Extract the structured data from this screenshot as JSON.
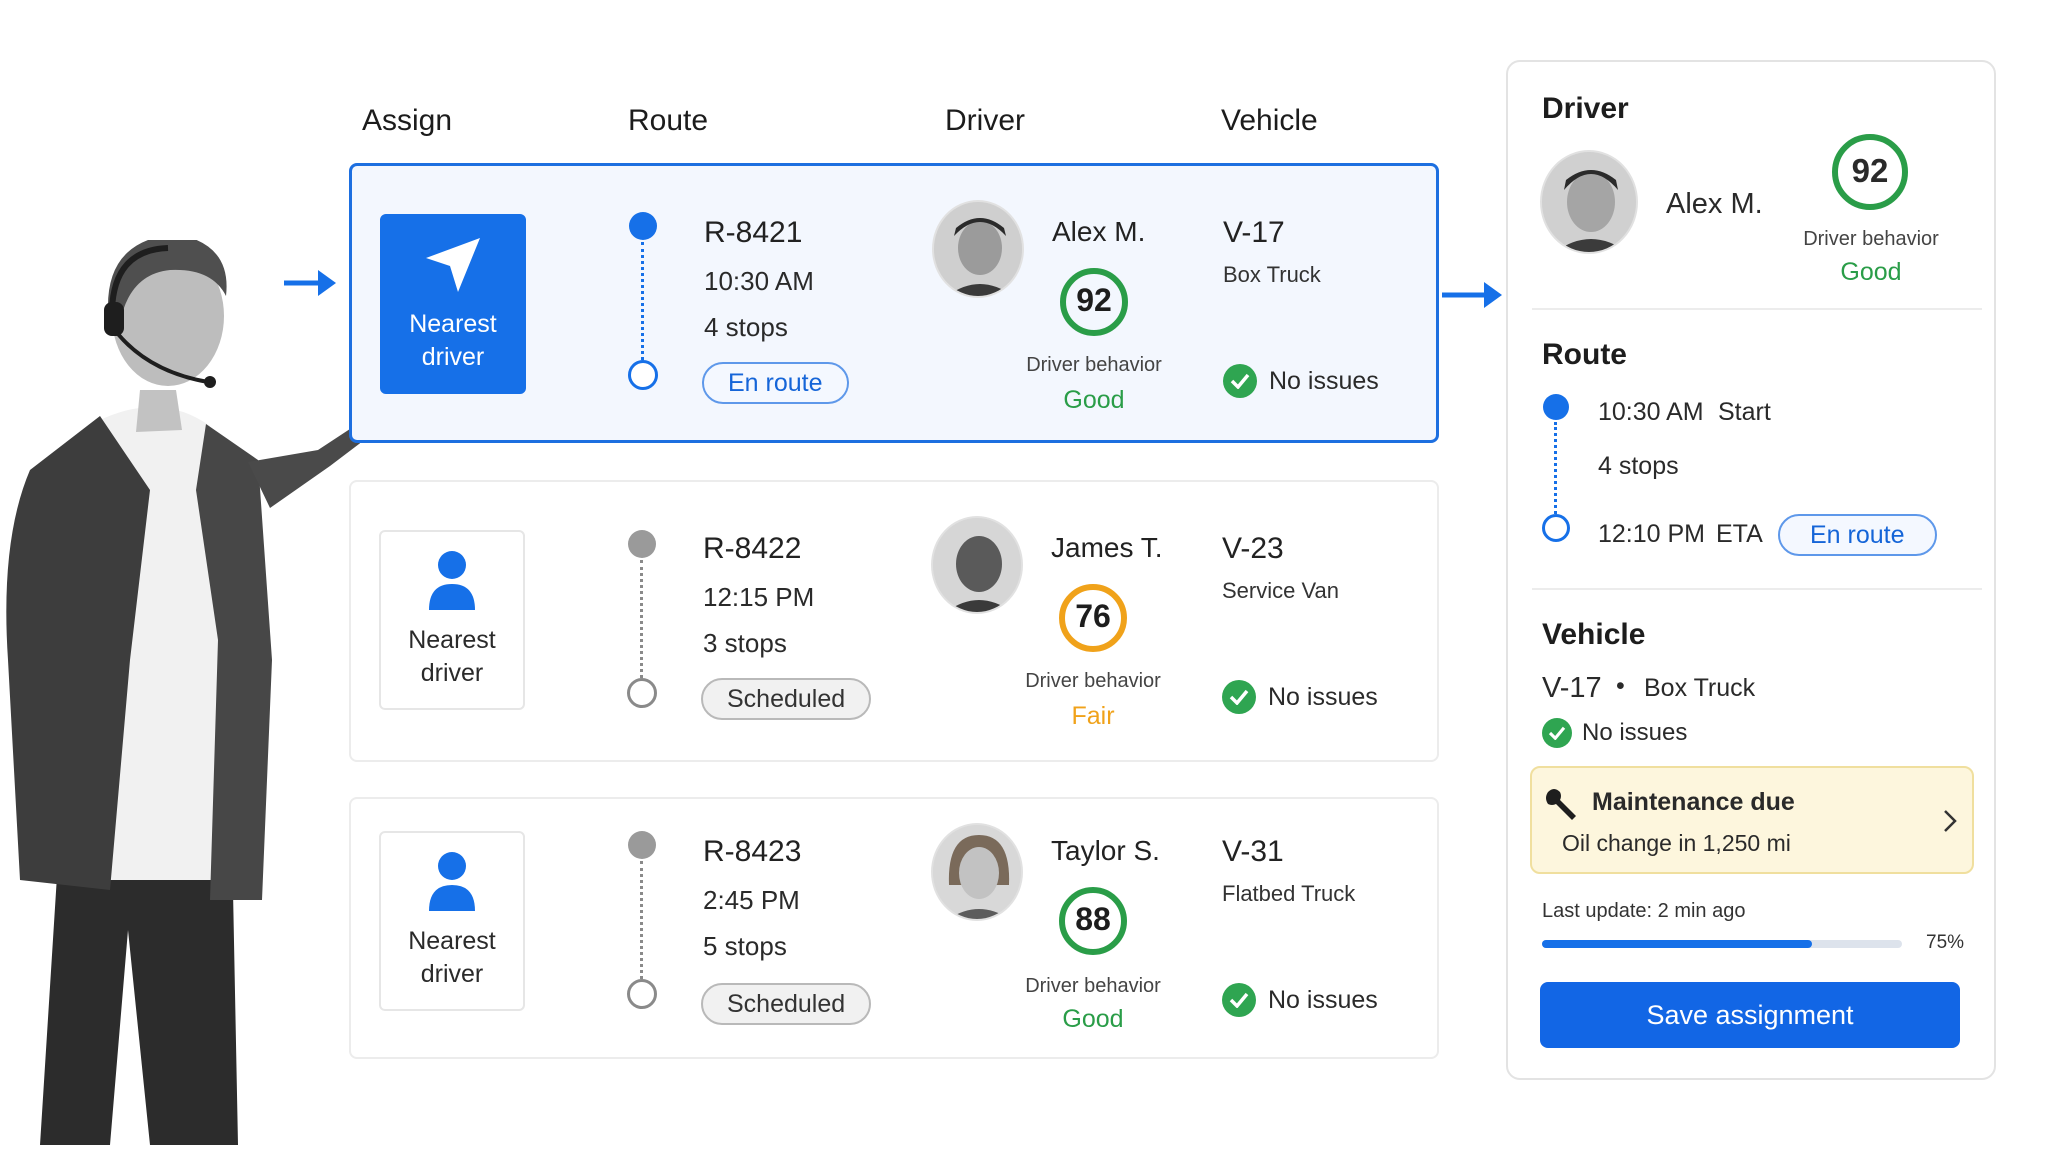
{
  "headers": {
    "assign": "Assign",
    "route": "Route",
    "driver": "Driver",
    "vehicle": "Vehicle"
  },
  "rows": [
    {
      "assign_label": "Nearest driver",
      "route_id": "R-8421",
      "time": "10:30 AM",
      "stops": "4 stops",
      "status": "En route",
      "driver_name": "Alex M.",
      "score": "92",
      "behavior_label": "Driver behavior",
      "behavior": "Good",
      "vehicle_id": "V-17",
      "vehicle_type": "Box Truck",
      "issues": "No issues"
    },
    {
      "assign_label": "Nearest driver",
      "route_id": "R-8422",
      "time": "12:15 PM",
      "stops": "3 stops",
      "status": "Scheduled",
      "driver_name": "James T.",
      "score": "76",
      "behavior_label": "Driver behavior",
      "behavior": "Fair",
      "vehicle_id": "V-23",
      "vehicle_type": "Service Van",
      "issues": "No issues"
    },
    {
      "assign_label": "Nearest driver",
      "route_id": "R-8423",
      "time": "2:45 PM",
      "stops": "5 stops",
      "status": "Scheduled",
      "driver_name": "Taylor S.",
      "score": "88",
      "behavior_label": "Driver behavior",
      "behavior": "Good",
      "vehicle_id": "V-31",
      "vehicle_type": "Flatbed Truck",
      "issues": "No issues"
    }
  ],
  "panel": {
    "driver_title": "Driver",
    "driver_name": "Alex M.",
    "score": "92",
    "behavior_label": "Driver behavior",
    "behavior": "Good",
    "route_title": "Route",
    "start_time": "10:30 AM",
    "start_label": "Start",
    "stops": "4 stops",
    "eta_time": "12:10 PM",
    "eta_label": "ETA",
    "status": "En route",
    "vehicle_title": "Vehicle",
    "vehicle_id": "V-17",
    "vehicle_sep": "•",
    "vehicle_type": "Box Truck",
    "issues": "No issues",
    "maintenance_title": "Maintenance due",
    "maintenance_detail": "Oil change in 1,250 mi",
    "last_update": "Last update: 2 min ago",
    "progress_label": "75%",
    "progress_value": 0.75,
    "save_label": "Save assignment"
  },
  "colors": {
    "accent": "#1670e8",
    "good": "#2a9d48",
    "fair": "#f0a21a",
    "check": "#2fa551"
  },
  "icons": {
    "assign_primary": "navigation-arrow-icon",
    "assign_secondary": "person-icon",
    "check": "check-circle-icon",
    "maintenance": "wrench-icon",
    "chevron": "chevron-right-icon"
  }
}
